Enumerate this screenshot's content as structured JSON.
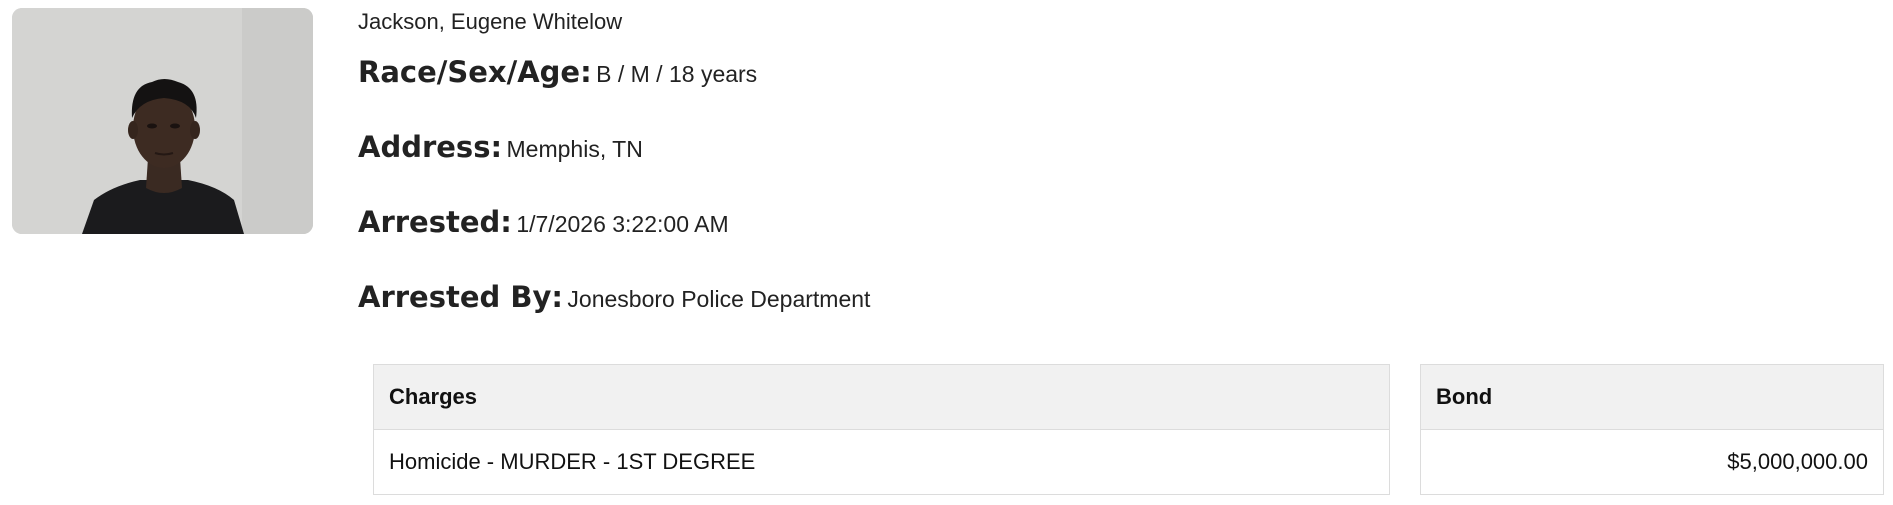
{
  "record": {
    "name": "Jackson, Eugene Whitelow",
    "fields": [
      {
        "label": "Race/Sex/Age:",
        "value": "B / M / 18 years"
      },
      {
        "label": "Address:",
        "value": "Memphis, TN"
      },
      {
        "label": "Arrested:",
        "value": "1/7/2026 3:22:00 AM"
      },
      {
        "label": "Arrested By:",
        "value": "Jonesboro Police Department"
      }
    ]
  },
  "charges_table": {
    "header": "Charges",
    "rows": [
      "Homicide - MURDER - 1ST DEGREE"
    ]
  },
  "bond_table": {
    "header": "Bond",
    "rows": [
      "$5,000,000.00"
    ]
  }
}
